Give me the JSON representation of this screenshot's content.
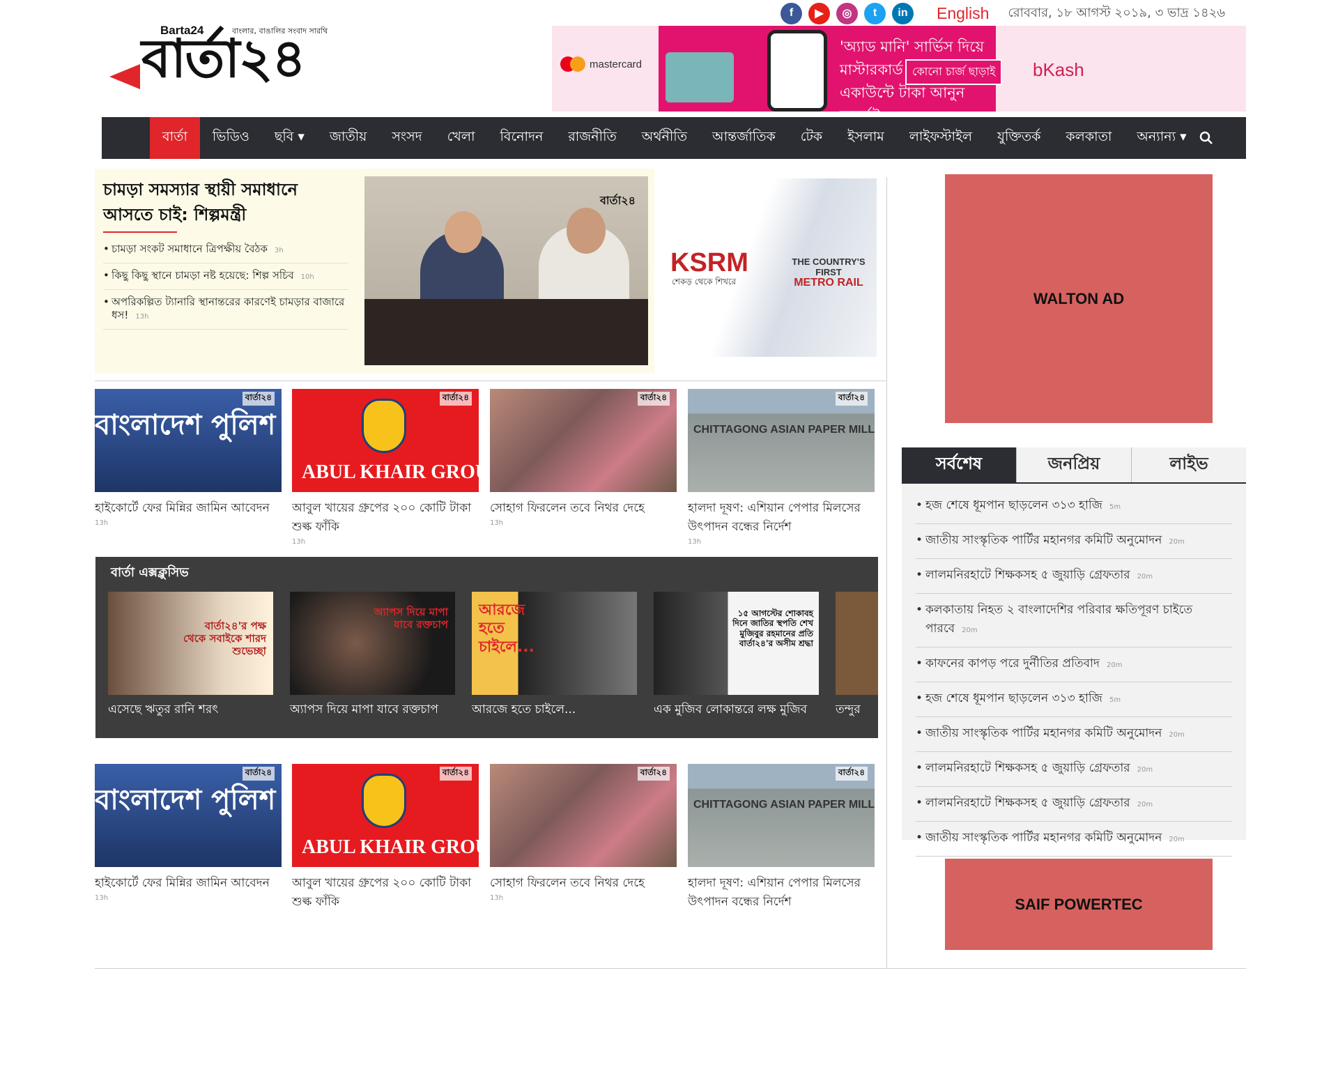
{
  "header": {
    "logo_en": "Barta24",
    "logo_tagline": "বাংলার, বাঙালির সংবাদ সারথি",
    "logo_main": "বার্তা২৪",
    "language_link": "English",
    "date": "রোববার, ১৮ আগস্ট ২০১৯, ৩ ভাদ্র ১৪২৬",
    "social": [
      {
        "name": "facebook-icon",
        "glyph": "f",
        "color": "#3b5998"
      },
      {
        "name": "youtube-icon",
        "glyph": "▶",
        "color": "#e62117"
      },
      {
        "name": "instagram-icon",
        "glyph": "◎",
        "color": "#c13584"
      },
      {
        "name": "twitter-icon",
        "glyph": "t",
        "color": "#1da1f2"
      },
      {
        "name": "linkedin-icon",
        "glyph": "in",
        "color": "#0077b5"
      }
    ]
  },
  "top_ad": {
    "brand": "mastercard",
    "text_line1": "'অ্যাড মানি' সার্ভিস দিয়ে",
    "text_line2": "মাস্টারকার্ড থেকে বিকাশ",
    "text_line3": "একাউন্টে টাকা আনুন মুহূর্তেই",
    "badge": "কোনো চার্জ ছাড়াই",
    "logo": "bKash"
  },
  "nav": {
    "items": [
      "বার্তা",
      "ভিডিও",
      "ছবি ▾",
      "জাতীয়",
      "সংসদ",
      "খেলা",
      "বিনোদন",
      "রাজনীতি",
      "অর্থনীতি",
      "আন্তর্জাতিক",
      "টেক",
      "ইসলাম",
      "লাইফস্টাইল",
      "যুক্তিতর্ক",
      "কলকাতা",
      "অন্যান্য ▾"
    ],
    "active_index": 0
  },
  "lead": {
    "title": "চামড়া সমস্যার স্থায়ী সমাধানে আসতে চাই: শিল্পমন্ত্রী",
    "watermark": "বার্তা২৪",
    "related": [
      {
        "title": "চামড়া সংকট সমাধানে ত্রিপক্ষীয় বৈঠক",
        "time": "3h"
      },
      {
        "title": "কিছু কিছু স্থানে চামড়া নষ্ট হয়েছে: শিল্প সচিব",
        "time": "10h"
      },
      {
        "title": "অপরিকল্পিত ট্যানারি স্থানান্তরের কারণেই চামড়ার বাজারে ধস!",
        "time": "13h"
      }
    ]
  },
  "side_ad": {
    "brand": "KSRM",
    "tagline": "শেকড় থেকে শিখরে",
    "headline_1": "THE COUNTRY'S FIRST",
    "headline_2": "METRO RAIL"
  },
  "cards_row1": [
    {
      "title": "হাইকোর্টে ফের মিন্নির জামিন আবেদন",
      "time": "13h",
      "overlay": "বাংলাদেশ পুলিশ"
    },
    {
      "title": "আবুল খায়ের গ্রুপের ২০০ কোটি টাকা শুল্ক ফাঁকি",
      "time": "13h",
      "overlay": "ABUL KHAIR GROUP"
    },
    {
      "title": "সোহাগ ফিরলেন তবে নিথর দেহে",
      "time": "13h",
      "overlay": ""
    },
    {
      "title": "হালদা দূষণ: এশিয়ান পেপার মিলসের উৎপাদন বন্ধের নির্দেশ",
      "time": "13h",
      "overlay": "CHITTAGONG ASIAN PAPER MILLS (PVT) LTD."
    }
  ],
  "exclusive": {
    "heading": "বার্তা এক্সক্লুসিভ",
    "items": [
      {
        "title": "এসেছে ঋতুর রানি শরৎ",
        "caption": "বার্তা২৪'র পক্ষ থেকে সবাইকে শারদ শুভেচ্ছা"
      },
      {
        "title": "অ্যাপস দিয়ে মাপা যাবে রক্তচাপ",
        "caption": "অ্যাপস দিয়ে মাপা যাবে রক্তচাপ"
      },
      {
        "title": "আরজে হতে চাইলে...",
        "caption": "আরজে হতে চাইলে..."
      },
      {
        "title": "এক মুজিব লোকান্তরে লক্ষ মুজিব",
        "caption": "১৫ আগস্টের শোকাবহ দিনে জাতির স্থপতি শেখ মুজিবুর রহমানের প্রতি বার্তা২৪'র অসীম শ্রদ্ধা"
      },
      {
        "title": "তন্দুর",
        "caption": ""
      }
    ]
  },
  "cards_row2": [
    {
      "title": "হাইকোর্টে ফের মিন্নির জামিন আবেদন",
      "time": "13h",
      "overlay": "বাংলাদেশ পুলিশ"
    },
    {
      "title": "আবুল খায়ের গ্রুপের ২০০ কোটি টাকা শুল্ক ফাঁকি",
      "time": "",
      "overlay": "ABUL KHAIR GROUP"
    },
    {
      "title": "সোহাগ ফিরলেন তবে নিথর দেহে",
      "time": "13h",
      "overlay": ""
    },
    {
      "title": "হালদা দূষণ: এশিয়ান পেপার মিলসের উৎপাদন বন্ধের নির্দেশ",
      "time": "",
      "overlay": "CHITTAGONG ASIAN PAPER MILLS (PVT) LTD."
    }
  ],
  "right": {
    "ad_top": "WALTON AD",
    "tabs": [
      "সর্বশেষ",
      "জনপ্রিয়",
      "লাইভ"
    ],
    "active_tab": 0,
    "latest": [
      {
        "title": "হজ শেষে ধূমপান ছাড়লেন ৩১৩ হাজি",
        "time": "5m"
      },
      {
        "title": "জাতীয় সাংস্কৃতিক পার্টির মহানগর কমিটি অনুমোদন",
        "time": "20m"
      },
      {
        "title": "লালমনিরহাটে শিক্ষকসহ ৫ জুয়াড়ি গ্রেফতার",
        "time": "20m"
      },
      {
        "title": "কলকাতায় নিহত ২ বাংলাদেশির পরিবার ক্ষতিপূরণ চাইতে পারবে",
        "time": "20m"
      },
      {
        "title": "কাফনের কাপড় পরে দুর্নীতির প্রতিবাদ",
        "time": "20m"
      },
      {
        "title": "হজ শেষে ধূমপান ছাড়লেন ৩১৩ হাজি",
        "time": "5m"
      },
      {
        "title": "জাতীয় সাংস্কৃতিক পার্টির মহানগর কমিটি অনুমোদন",
        "time": "20m"
      },
      {
        "title": "লালমনিরহাটে শিক্ষকসহ ৫ জুয়াড়ি গ্রেফতার",
        "time": "20m"
      },
      {
        "title": "লালমনিরহাটে শিক্ষকসহ ৫ জুয়াড়ি গ্রেফতার",
        "time": "20m"
      },
      {
        "title": "জাতীয় সাংস্কৃতিক পার্টির মহানগর কমিটি অনুমোদন",
        "time": "20m"
      }
    ],
    "ad_bottom": "SAIF POWERTEC"
  },
  "colors": {
    "accent": "#e0262b",
    "nav_bg": "#2b2d33",
    "ad_block": "#d6625f",
    "bkash": "#e2136e"
  }
}
